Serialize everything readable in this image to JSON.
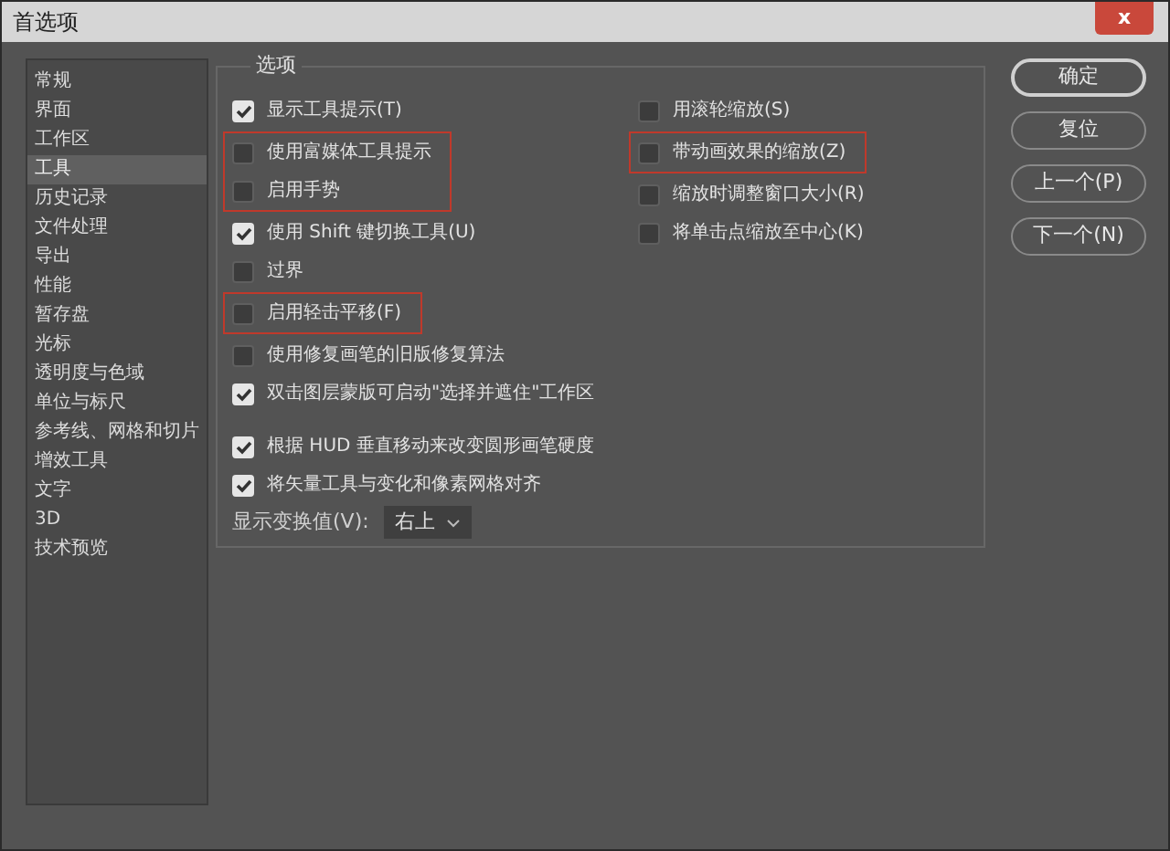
{
  "window": {
    "title": "首选项",
    "close": "x"
  },
  "sidebar": {
    "items": [
      {
        "label": "常规",
        "selected": false
      },
      {
        "label": "界面",
        "selected": false
      },
      {
        "label": "工作区",
        "selected": false
      },
      {
        "label": "工具",
        "selected": true
      },
      {
        "label": "历史记录",
        "selected": false
      },
      {
        "label": "文件处理",
        "selected": false
      },
      {
        "label": "导出",
        "selected": false
      },
      {
        "label": "性能",
        "selected": false
      },
      {
        "label": "暂存盘",
        "selected": false
      },
      {
        "label": "光标",
        "selected": false
      },
      {
        "label": "透明度与色域",
        "selected": false
      },
      {
        "label": "单位与标尺",
        "selected": false
      },
      {
        "label": "参考线、网格和切片",
        "selected": false
      },
      {
        "label": "增效工具",
        "selected": false
      },
      {
        "label": "文字",
        "selected": false
      },
      {
        "label": "3D",
        "selected": false
      },
      {
        "label": "技术预览",
        "selected": false
      }
    ]
  },
  "options": {
    "title": "选项",
    "left_groups": [
      {
        "highlighted": false,
        "items": [
          {
            "label": "显示工具提示(T)",
            "checked": true
          }
        ]
      },
      {
        "highlighted": true,
        "items": [
          {
            "label": "使用富媒体工具提示",
            "checked": false
          },
          {
            "label": "启用手势",
            "checked": false
          }
        ]
      },
      {
        "highlighted": false,
        "items": [
          {
            "label": "使用 Shift 键切换工具(U)",
            "checked": true
          },
          {
            "label": "过界",
            "checked": false
          }
        ]
      },
      {
        "highlighted": true,
        "items": [
          {
            "label": "启用轻击平移(F)",
            "checked": false
          }
        ]
      },
      {
        "highlighted": false,
        "items": [
          {
            "label": "使用修复画笔的旧版修复算法",
            "checked": false
          },
          {
            "label": "双击图层蒙版可启动\"选择并遮住\"工作区",
            "checked": true
          }
        ]
      },
      {
        "highlighted": false,
        "items": [
          {
            "label": "根据 HUD 垂直移动来改变圆形画笔硬度",
            "checked": true
          },
          {
            "label": "将矢量工具与变化和像素网格对齐",
            "checked": true
          }
        ]
      }
    ],
    "right_groups": [
      {
        "highlighted": false,
        "items": [
          {
            "label": "用滚轮缩放(S)",
            "checked": false
          }
        ]
      },
      {
        "highlighted": true,
        "items": [
          {
            "label": "带动画效果的缩放(Z)",
            "checked": false
          }
        ]
      },
      {
        "highlighted": false,
        "items": [
          {
            "label": "缩放时调整窗口大小(R)",
            "checked": false
          },
          {
            "label": "将单击点缩放至中心(K)",
            "checked": false
          }
        ]
      }
    ],
    "transform": {
      "label": "显示变换值(V):",
      "value": "右上"
    }
  },
  "buttons": [
    {
      "label": "确定",
      "default": true
    },
    {
      "label": "复位",
      "default": false
    },
    {
      "label": "上一个(P)",
      "default": false
    },
    {
      "label": "下一个(N)",
      "default": false
    }
  ]
}
